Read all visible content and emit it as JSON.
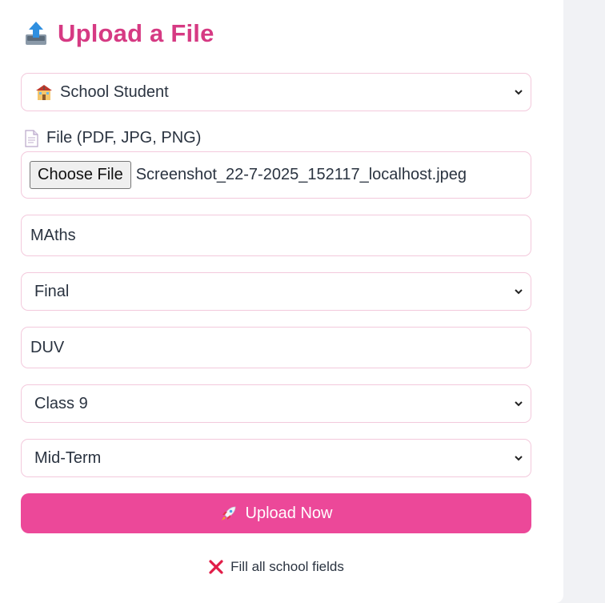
{
  "title": "Upload a File",
  "user_type_select": {
    "value": "School Student",
    "icon": "school-icon"
  },
  "file_label": "File (PDF, JPG, PNG)",
  "file_input": {
    "button_label": "Choose File",
    "file_name": "Screenshot_22-7-2025_152117_localhost.jpeg"
  },
  "subject_input": {
    "value": "MAths"
  },
  "exam_type_select": {
    "value": "Final"
  },
  "school_input": {
    "value": "DUV"
  },
  "class_select": {
    "value": "Class 9"
  },
  "term_select": {
    "value": "Mid-Term"
  },
  "upload_button": {
    "label": "Upload Now",
    "icon": "rocket-icon"
  },
  "status_message": {
    "text": "Fill all school fields",
    "icon": "cross-icon"
  },
  "colors": {
    "accent": "#ec4899",
    "title": "#d63a83",
    "field_border": "#f3c9dc",
    "error": "#e11d48"
  }
}
